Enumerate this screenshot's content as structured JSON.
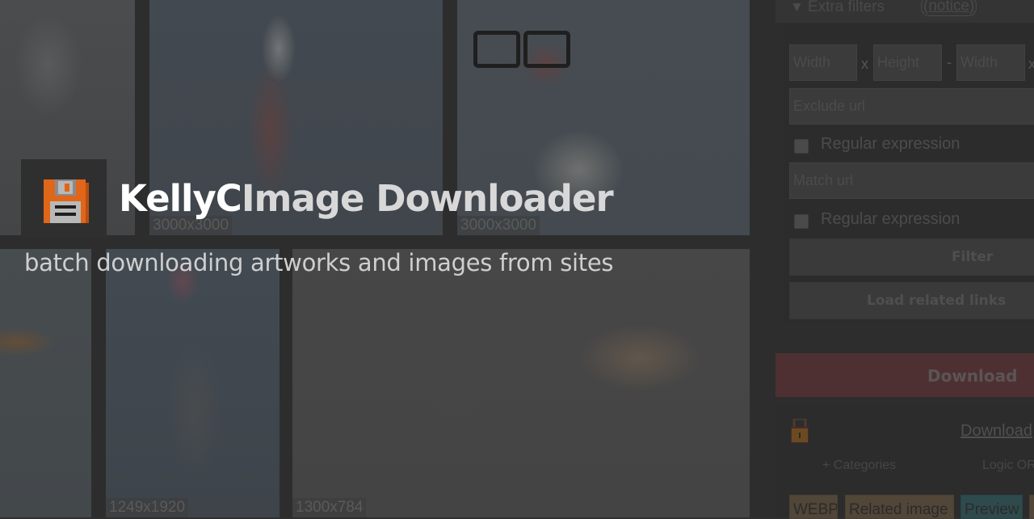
{
  "header": {
    "brand_part1": "KellyC",
    "brand_part2": "Image Downloader",
    "tagline": "batch downloading artworks and images from sites",
    "logo_icon": "floppy-disk-icon"
  },
  "gallery": {
    "tiles": [
      {
        "size": ""
      },
      {
        "size": "3000x3000"
      },
      {
        "size": "3000x3000"
      },
      {
        "size": ""
      },
      {
        "size": "1249x1920"
      },
      {
        "size": "1300x784"
      }
    ]
  },
  "panel": {
    "extra_filters": {
      "toggle_icon": "triangle-down-icon",
      "label": "Extra filters",
      "notice": "(notice)"
    },
    "size_filter": {
      "min_width_placeholder": "Width",
      "min_height_placeholder": "Height",
      "max_width_placeholder": "Width",
      "x_sep": "x",
      "range_sep": "-"
    },
    "exclude_url": {
      "placeholder": "Exclude url",
      "regex_label": "Regular expression"
    },
    "match_url": {
      "placeholder": "Match url",
      "regex_label": "Regular expression"
    },
    "filter_button": "Filter",
    "load_related_button": "Load related links",
    "download_button": "Download",
    "lock_icon": "lock-icon",
    "download_link": "Download",
    "categories_link": "+ Categories",
    "logic_label": "Logic OR",
    "tags": [
      {
        "label": "WEBP",
        "color": "#514638"
      },
      {
        "label": "Related image",
        "color": "#514638"
      },
      {
        "label": "Preview",
        "color": "#2f4a4c"
      },
      {
        "label": "",
        "color": "#514638"
      }
    ]
  },
  "colors": {
    "accent_download": "#4f3032",
    "logo_orange": "#e0661a",
    "panel_bg": "#2d2d2d"
  }
}
